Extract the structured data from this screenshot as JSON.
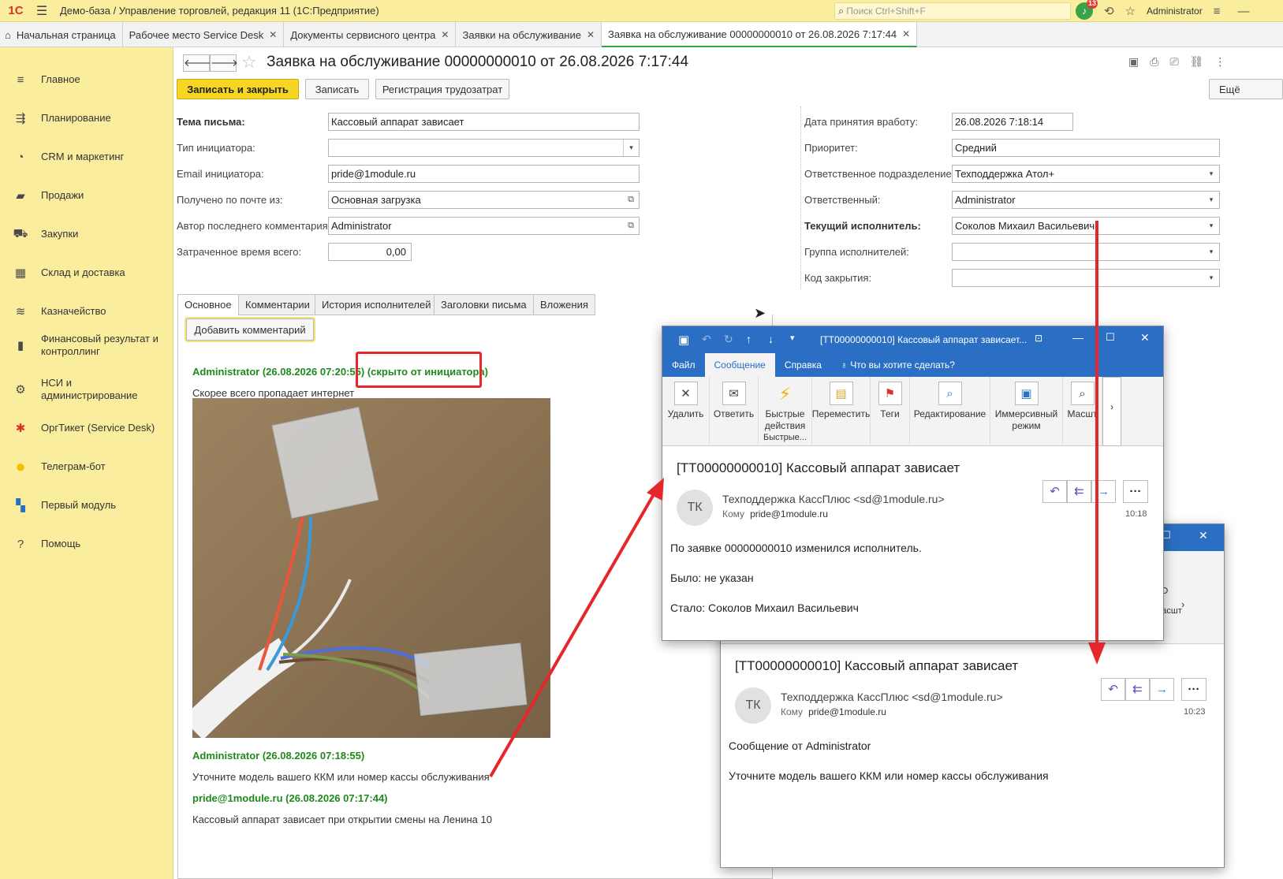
{
  "topbar": {
    "logo": "1С",
    "title": "Демо-база / Управление торговлей, редакция 11  (1С:Предприятие)",
    "search_placeholder": "Поиск Ctrl+Shift+F",
    "notif_count": "13",
    "user": "Administrator"
  },
  "tabs": [
    {
      "label": "Начальная страница"
    },
    {
      "label": "Рабочее место Service Desk"
    },
    {
      "label": "Документы сервисного центра"
    },
    {
      "label": "Заявки на обслуживание"
    },
    {
      "label": "Заявка на обслуживание 00000000010 от 26.08.2026 7:17:44"
    }
  ],
  "sidebar": {
    "items": [
      {
        "icon": "menu-icon",
        "glyph": "≡",
        "label": "Главное"
      },
      {
        "icon": "planning-icon",
        "glyph": "⇶",
        "label": "Планирование"
      },
      {
        "icon": "crm-icon",
        "glyph": "◔",
        "label": "CRM и маркетинг"
      },
      {
        "icon": "sales-bag-icon",
        "glyph": "▰",
        "label": "Продажи"
      },
      {
        "icon": "cart-icon",
        "glyph": "⛟",
        "label": "Закупки"
      },
      {
        "icon": "warehouse-icon",
        "glyph": "▦",
        "label": "Склад и доставка"
      },
      {
        "icon": "treasury-icon",
        "glyph": "≋",
        "label": "Казначейство"
      },
      {
        "icon": "finance-chart-icon",
        "glyph": "▮",
        "label": "Финансовый результат и контроллинг"
      },
      {
        "icon": "gear-icon",
        "glyph": "⚙",
        "label": "НСИ и администрирование"
      },
      {
        "icon": "orgticket-icon",
        "glyph": "✱",
        "label": "ОргТикет (Service Desk)"
      },
      {
        "icon": "telegram-bot-icon",
        "glyph": "●",
        "label": "Телеграм-бот"
      },
      {
        "icon": "first-module-icon",
        "glyph": "▚",
        "label": "Первый модуль"
      },
      {
        "icon": "help-icon",
        "glyph": "?",
        "label": "Помощь"
      }
    ]
  },
  "form": {
    "title": "Заявка на обслуживание 00000000010 от 26.08.2026 7:17:44",
    "save_close": "Записать и закрыть",
    "save": "Записать",
    "labor": "Регистрация трудозатрат",
    "more": "Ещё",
    "left_fields": [
      {
        "label": "Тема письма:",
        "value": "Кассовый аппарат зависает",
        "bold": true
      },
      {
        "label": "Тип инициатора:",
        "value": ""
      },
      {
        "label": "Email инициатора:",
        "value": "pride@1module.ru"
      },
      {
        "label": "Получено по почте из:",
        "value": "Основная загрузка"
      },
      {
        "label": "Автор последнего комментария:",
        "value": "Administrator"
      },
      {
        "label": "Затраченное время всего:",
        "value": "0,00"
      }
    ],
    "right_fields": [
      {
        "label": "Дата принятия вработу:",
        "value": "26.08.2026  7:18:14"
      },
      {
        "label": "Приоритет:",
        "value": "Средний"
      },
      {
        "label": "Ответственное подразделение:",
        "value": "Техподдержка Атол+"
      },
      {
        "label": "Ответственный:",
        "value": "Administrator"
      },
      {
        "label": "Текущий исполнитель:",
        "value": "Соколов Михаил Васильевич",
        "bold": true
      },
      {
        "label": "Группа исполнителей:",
        "value": ""
      },
      {
        "label": "Код закрытия:",
        "value": ""
      }
    ],
    "form_tabs": [
      "Основное",
      "Комментарии",
      "История исполнителей",
      "Заголовки письма",
      "Вложения"
    ],
    "add_comment": "Добавить комментарий",
    "comments": [
      {
        "head": "Administrator (26.08.2026 07:20:55)",
        "hidden": "(скрыто от инициатора)",
        "text": "Скорее всего пропадает интернет"
      },
      {
        "head": "Administrator (26.08.2026 07:18:55)",
        "text": "Уточните модель вашего ККМ или номер кассы обслуживания"
      },
      {
        "head": "pride@1module.ru (26.08.2026 07:17:44)",
        "text": "Кассовый аппарат зависает при открытии смены на Ленина 10"
      }
    ]
  },
  "email1": {
    "window_title": "[TT00000000010] Кассовый аппарат зависает...",
    "menu": [
      "Файл",
      "Сообщение",
      "Справка"
    ],
    "tell_me": "Что вы хотите сделать?",
    "ribbon": [
      {
        "label": "Удалить",
        "glyph": "✕",
        "icon": "delete-icon"
      },
      {
        "label": "Ответить",
        "glyph": "✉",
        "icon": "reply-mail-icon"
      },
      {
        "label": "Быстрые действия",
        "glyph": "⚡",
        "icon": "quick-actions-icon"
      },
      {
        "label": "Переместить",
        "glyph": "▤",
        "icon": "move-folder-icon"
      },
      {
        "label": "Теги",
        "glyph": "⚑",
        "icon": "flag-icon"
      },
      {
        "label": "Редактирование",
        "glyph": "⌕",
        "icon": "search-icon"
      },
      {
        "label": "Иммерсивный режим",
        "glyph": "▣",
        "icon": "immersive-reader-icon"
      },
      {
        "label": "Масшт",
        "glyph": "⌕",
        "icon": "zoom-icon"
      }
    ],
    "quick_group": "Быстрые...",
    "zoom_group": "Масшт",
    "subject": "[TT00000000010] Кассовый аппарат зависает",
    "avatar": "ТК",
    "sender": "Техподдержка КассПлюс <sd@1module.ru>",
    "to_label": "Кому",
    "to": "pride@1module.ru",
    "time": "10:18",
    "body": [
      "По заявке 00000000010 изменился исполнитель.",
      "Было: не указан",
      "Стало: Соколов Михаил Васильевич"
    ]
  },
  "email2": {
    "zoom_label": "Масшт",
    "subject": "[TT00000000010] Кассовый аппарат зависает",
    "avatar": "ТК",
    "sender": "Техподдержка КассПлюс <sd@1module.ru>",
    "to_label": "Кому",
    "to": "pride@1module.ru",
    "time": "10:23",
    "body": [
      "Сообщение от Administrator",
      "Уточните модель вашего ККМ или номер кассы обслуживания"
    ]
  },
  "colors": {
    "accent_yellow": "#fbed9e",
    "save_button": "#f6d523",
    "comment_green": "#1e8a1e",
    "annotation_red": "#e5272b",
    "outlook_blue": "#2b6fc4"
  }
}
